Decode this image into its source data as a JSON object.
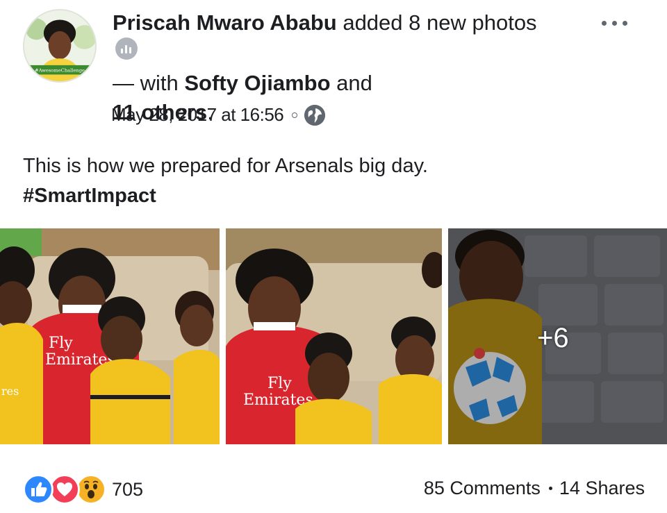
{
  "post": {
    "author": "Priscah Mwaro Ababu",
    "action_text": "added 8 new photos",
    "with_prefix": "— with",
    "tagged_person": "Softy Ojiambo",
    "and_text": "and",
    "others": "11 others",
    "period": ".",
    "timestamp": "May 28, 2017 at 16:56",
    "avatar_caption": "#AwesomeChallenge",
    "text_line": "This is how we prepared for Arsenals big day.",
    "hashtag": "#SmartImpact",
    "more_photos": "+6",
    "reaction_count": "705",
    "comments": "85 Comments",
    "shares": "14 Shares",
    "photo_shirt_text_1": "Fly",
    "photo_shirt_text_2": "Emirates"
  },
  "icons": {
    "insights": "bar-chart-icon",
    "more": "more-dots-icon",
    "privacy": "globe-icon",
    "like": "like-icon",
    "love": "love-icon",
    "wow": "wow-icon"
  },
  "colors": {
    "like": "#2d88ff",
    "love": "#f33e58",
    "wow": "#f7b125",
    "arsenal_red": "#d9262e",
    "kit_yellow": "#f2c21f"
  }
}
